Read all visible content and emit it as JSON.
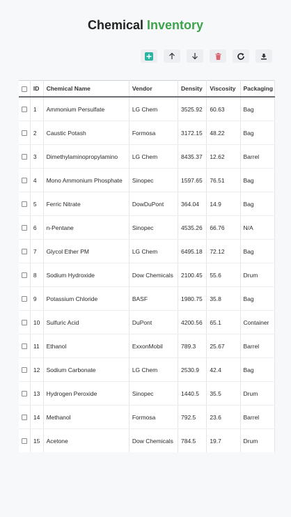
{
  "title": {
    "part1": "Chemical",
    "part2": "Inventory"
  },
  "toolbar": {
    "buttons": [
      {
        "icon": "plus-square-icon",
        "color": "#2bb5a0"
      },
      {
        "icon": "arrow-up-icon",
        "color": "#333333"
      },
      {
        "icon": "arrow-down-icon",
        "color": "#333333"
      },
      {
        "icon": "trash-icon",
        "color": "#d96570"
      },
      {
        "icon": "refresh-icon",
        "color": "#222222"
      },
      {
        "icon": "save-icon",
        "color": "#333333"
      }
    ]
  },
  "table": {
    "headers": {
      "id": "ID",
      "name": "Chemical Name",
      "vendor": "Vendor",
      "density": "Density",
      "viscosity": "Viscosity",
      "packaging": "Packaging"
    },
    "rows": [
      {
        "id": "1",
        "name": "Ammonium Persulfate",
        "vendor": "LG Chem",
        "density": "3525.92",
        "viscosity": "60.63",
        "packaging": "Bag"
      },
      {
        "id": "2",
        "name": "Caustic Potash",
        "vendor": "Formosa",
        "density": "3172.15",
        "viscosity": "48.22",
        "packaging": "Bag"
      },
      {
        "id": "3",
        "name": "Dimethylaminopropylamino",
        "vendor": "LG Chem",
        "density": "8435.37",
        "viscosity": "12.62",
        "packaging": "Barrel"
      },
      {
        "id": "4",
        "name": "Mono Ammonium Phosphate",
        "vendor": "Sinopec",
        "density": "1597.65",
        "viscosity": "76.51",
        "packaging": "Bag"
      },
      {
        "id": "5",
        "name": "Ferric Nitrate",
        "vendor": "DowDuPont",
        "density": "364.04",
        "viscosity": "14.9",
        "packaging": "Bag"
      },
      {
        "id": "6",
        "name": "n-Pentane",
        "vendor": "Sinopec",
        "density": "4535.26",
        "viscosity": "66.76",
        "packaging": "N/A"
      },
      {
        "id": "7",
        "name": "Glycol Ether PM",
        "vendor": "LG Chem",
        "density": "6495.18",
        "viscosity": "72.12",
        "packaging": "Bag"
      },
      {
        "id": "8",
        "name": "Sodium Hydroxide",
        "vendor": "Dow Chemicals",
        "density": "2100.45",
        "viscosity": "55.6",
        "packaging": "Drum"
      },
      {
        "id": "9",
        "name": "Potassium Chloride",
        "vendor": "BASF",
        "density": "1980.75",
        "viscosity": "35.8",
        "packaging": "Bag"
      },
      {
        "id": "10",
        "name": "Sulfuric Acid",
        "vendor": "DuPont",
        "density": "4200.56",
        "viscosity": "65.1",
        "packaging": "Container"
      },
      {
        "id": "11",
        "name": "Ethanol",
        "vendor": "ExxonMobil",
        "density": "789.3",
        "viscosity": "25.67",
        "packaging": "Barrel"
      },
      {
        "id": "12",
        "name": "Sodium Carbonate",
        "vendor": "LG Chem",
        "density": "2530.9",
        "viscosity": "42.4",
        "packaging": "Bag"
      },
      {
        "id": "13",
        "name": "Hydrogen Peroxide",
        "vendor": "Sinopec",
        "density": "1440.5",
        "viscosity": "35.5",
        "packaging": "Drum"
      },
      {
        "id": "14",
        "name": "Methanol",
        "vendor": "Formosa",
        "density": "792.5",
        "viscosity": "23.6",
        "packaging": "Barrel"
      },
      {
        "id": "15",
        "name": "Acetone",
        "vendor": "Dow Chemicals",
        "density": "784.5",
        "viscosity": "19.7",
        "packaging": "Drum"
      }
    ]
  }
}
